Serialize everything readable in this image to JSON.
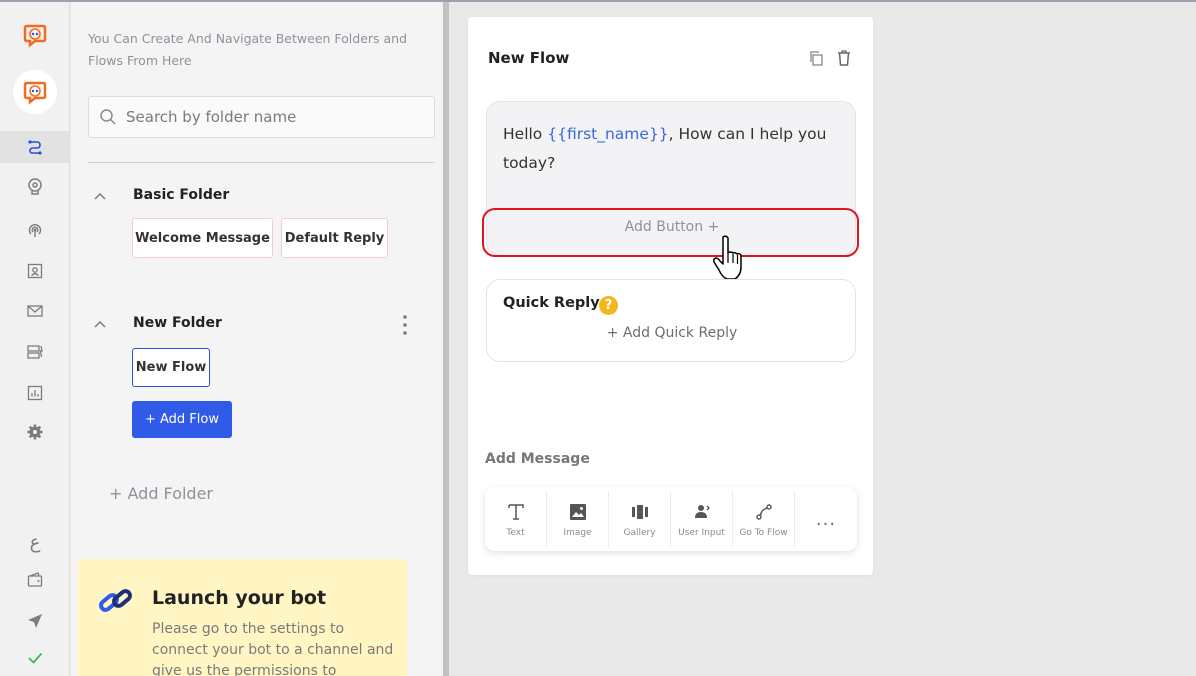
{
  "rail": {
    "icons": [
      "botit-logo",
      "botit-logo-active",
      "flow-icon",
      "brain-icon",
      "broadcast-icon",
      "contacts-icon",
      "mail-icon",
      "forms-icon",
      "analytics-icon",
      "gear-icon",
      "language-icon",
      "wallet-icon",
      "send-icon",
      "check-icon"
    ],
    "language_glyph": "ع",
    "accent": "#f26b21"
  },
  "folders_panel": {
    "hint": "You Can Create And Navigate Between Folders and Flows From Here",
    "search": {
      "placeholder": "Search by folder name",
      "value": ""
    },
    "folders": [
      {
        "name": "Basic Folder",
        "flows": [
          "Welcome Message",
          "Default Reply"
        ]
      },
      {
        "name": "New Folder",
        "flows": [
          "New Flow"
        ],
        "selected_flow": "New Flow"
      }
    ],
    "add_flow_label": "+ Add Flow",
    "add_folder_label": "+ Add Folder",
    "launch": {
      "title": "Launch your bot",
      "body": "Please go to the settings to connect your bot to a channel and give us the permissions to"
    }
  },
  "flow_card": {
    "title": "New Flow",
    "message": {
      "prefix": "Hello ",
      "variable": "{{first_name}}",
      "suffix": ", How can I help you today?"
    },
    "add_button_label": "Add Button +",
    "quick_reply": {
      "label": "Quick Reply",
      "help": "?",
      "add_label": "+ Add Quick Reply"
    },
    "add_message_label": "Add Message",
    "tools": [
      {
        "label": "Text",
        "icon": "text-icon"
      },
      {
        "label": "Image",
        "icon": "image-icon"
      },
      {
        "label": "Gallery",
        "icon": "gallery-icon"
      },
      {
        "label": "User Input",
        "icon": "user-input-icon"
      },
      {
        "label": "Go To Flow",
        "icon": "go-to-flow-icon"
      }
    ],
    "more_label": "..."
  },
  "colors": {
    "primary": "#2f5be8",
    "highlight": "#e0141c",
    "variable": "#3d67e0",
    "help": "#f5b81c",
    "launch_bg": "#fff6c4"
  }
}
